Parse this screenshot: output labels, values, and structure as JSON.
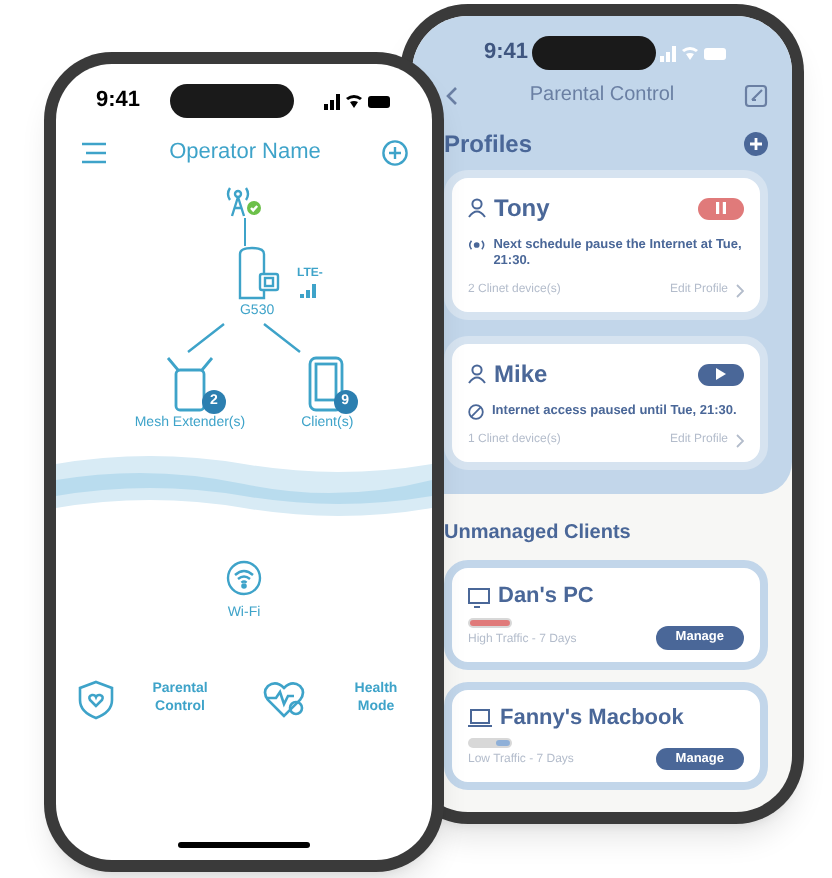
{
  "home_phone": {
    "status_bar": {
      "time": "9:41"
    },
    "header": {
      "title": "Operator Name"
    },
    "topology": {
      "gateway": {
        "name": "G530",
        "cellular": "LTE-"
      },
      "nodes": [
        {
          "kind": "extender",
          "label": "Mesh Extender(s)",
          "count": "2"
        },
        {
          "kind": "client",
          "label": "Client(s)",
          "count": "9"
        }
      ]
    },
    "wifi": {
      "label": "Wi-Fi"
    },
    "features": [
      {
        "kind": "shield",
        "label": "Parental Control"
      },
      {
        "kind": "heart",
        "label": "Health Mode"
      }
    ]
  },
  "parental_phone": {
    "status_bar": {
      "time": "9:41"
    },
    "header": {
      "title": "Parental Control"
    },
    "profiles_title": "Profiles",
    "profiles": [
      {
        "name": "Tony",
        "paused": false,
        "kind": "schedule",
        "status": "Next schedule pause the Internet at Tue, 21:30.",
        "devices": "2 Clinet device(s)",
        "edit": "Edit Profile"
      },
      {
        "name": "Mike",
        "paused": true,
        "kind": "blocked",
        "status": "Internet access paused until Tue, 21:30.",
        "devices": "1 Clinet device(s)",
        "edit": "Edit Profile"
      }
    ],
    "unmanaged_title": "Unmanaged Clients",
    "clients": [
      {
        "kind": "desktop",
        "name": "Dan's PC",
        "level": 1,
        "traffic_label": "High Traffic - 7 Days",
        "action": "Manage"
      },
      {
        "kind": "laptop",
        "name": "Fanny's Macbook",
        "level": 0.33,
        "traffic_label": "Low Traffic - 7 Days",
        "action": "Manage"
      }
    ]
  }
}
